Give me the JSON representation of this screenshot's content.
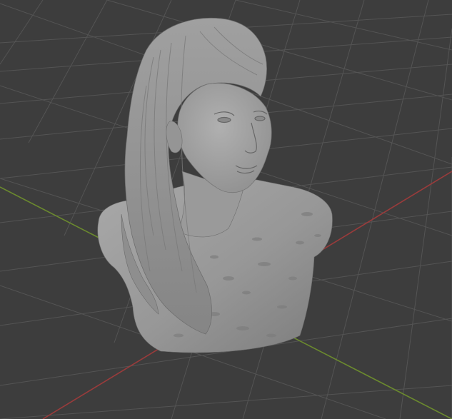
{
  "viewport": {
    "mode": "solid-shading",
    "background_color": "#3d3d3d",
    "grid_color": "#545454",
    "x_axis_color": "#9a3b3b",
    "y_axis_color": "#6b8a2e",
    "model_color": "#9c9c9c"
  },
  "model": {
    "name": "bust-sculpt",
    "icon": "sculpted-bust-mesh"
  }
}
